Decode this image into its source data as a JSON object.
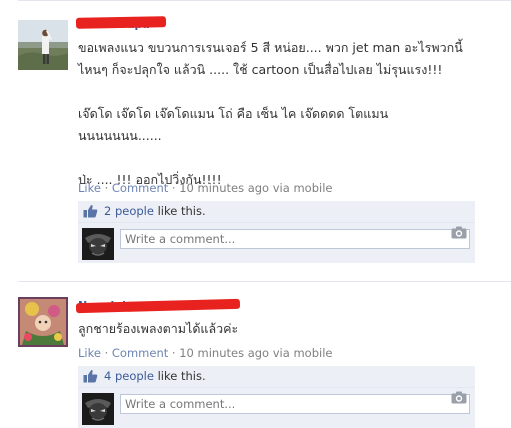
{
  "posts": [
    {
      "author": "Ken Burapa",
      "message_lines": [
        "ขอเพลงแนว ขบวนการเรนเจอร์ 5 สี หน่อย.... พวก jet man อะไรพวกนี้",
        "ไหนๆ ก็จะปลุกใจ แล้วนิ ..... ใช้ cartoon เป็นสื่อไปเลย ไม่รุนแรง!!!",
        "",
        "เจ๊ดโด เจ๊ดโด เจ๊ดโดแมน โถ่ คือ เซ็น ไค เจ๊ดดดด โตแมน",
        "นนนนนนน......",
        "",
        "ป่ะ .... !!! ออกไปวิ่งกัน!!!!"
      ],
      "actions": {
        "like": "Like",
        "sep1": " · ",
        "comment": "Comment",
        "sep2": " · ",
        "time": "10 minutes ago via mobile"
      },
      "likes": {
        "people": "2 people",
        "suffix": " like this."
      },
      "comment_placeholder": "Write a comment..."
    },
    {
      "author": "Nongluk",
      "message_lines": [
        "ลูกชายร้องเพลงตามได้แล้วค่ะ"
      ],
      "actions": {
        "like": "Like",
        "sep1": " · ",
        "comment": "Comment",
        "sep2": " · ",
        "time": "10 minutes ago via mobile"
      },
      "likes": {
        "people": "4 people",
        "suffix": " like this."
      },
      "comment_placeholder": "Write a comment..."
    }
  ]
}
